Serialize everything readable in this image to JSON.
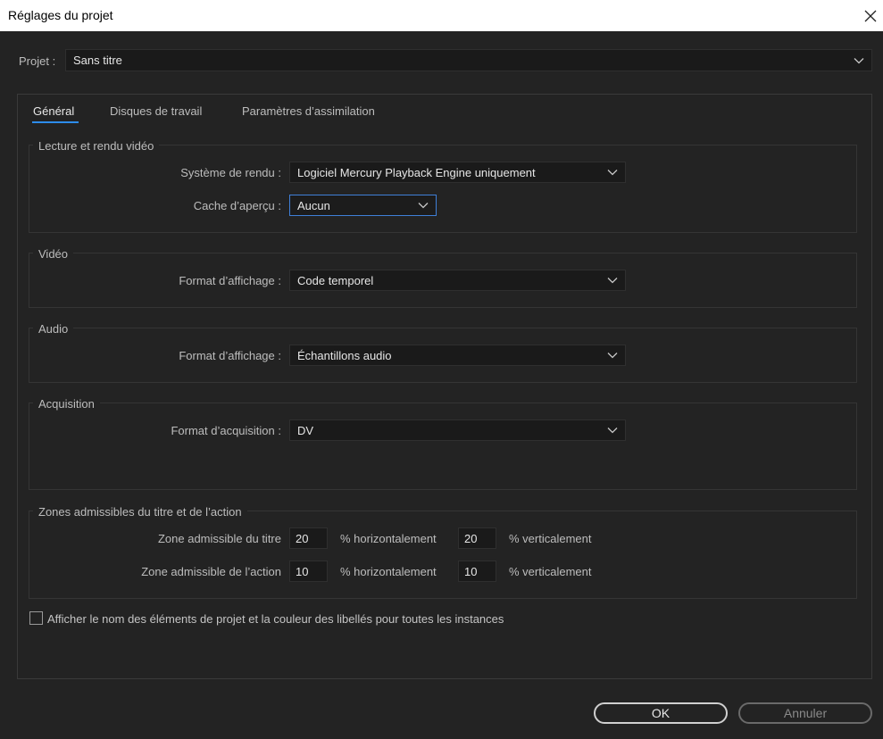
{
  "window": {
    "title": "Réglages du projet"
  },
  "project": {
    "label": "Projet :",
    "value": "Sans titre"
  },
  "tabs": [
    {
      "label": "Général",
      "active": true
    },
    {
      "label": "Disques de travail",
      "active": false
    },
    {
      "label": "Paramètres d’assimilation",
      "active": false
    }
  ],
  "playback": {
    "title": "Lecture et rendu vidéo",
    "renderer_label": "Système de rendu :",
    "renderer_value": "Logiciel Mercury Playback Engine uniquement",
    "cache_label": "Cache d’aperçu :",
    "cache_value": "Aucun"
  },
  "video": {
    "title": "Vidéo",
    "format_label": "Format d’affichage :",
    "format_value": "Code temporel"
  },
  "audio": {
    "title": "Audio",
    "format_label": "Format d’affichage :",
    "format_value": "Échantillons audio"
  },
  "capture": {
    "title": "Acquisition",
    "format_label": "Format d’acquisition :",
    "format_value": "DV"
  },
  "safe_zones": {
    "title": "Zones admissibles du titre et de l’action",
    "title_label": "Zone admissible du titre",
    "title_h": "20",
    "title_v": "20",
    "action_label": "Zone admissible de l’action",
    "action_h": "10",
    "action_v": "10",
    "h_unit": "% horizontalement",
    "v_unit": "% verticalement"
  },
  "checkbox": {
    "label": "Afficher le nom des éléments de projet et la couleur des libellés pour toutes les instances",
    "checked": false
  },
  "buttons": {
    "ok": "OK",
    "cancel": "Annuler"
  },
  "colors": {
    "accent": "#2d8ceb",
    "background": "#232323",
    "field": "#1a1a1a",
    "focus_border": "#3f7fd8"
  }
}
